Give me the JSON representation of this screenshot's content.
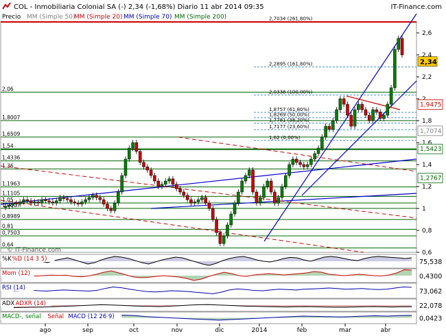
{
  "header": {
    "title_line": "COL - Inmobiliaria Colonial SA (-)   2,34 (-1,68%)   Diario  11 abr 2014 09:35",
    "brand": "IT-Finance.com",
    "watermark": "© IT-Finance.com"
  },
  "legend": {
    "precio": "Precio",
    "items": [
      {
        "label": "MM (Simple 50)",
        "color": "#808080"
      },
      {
        "label": "MM (Simple 20)",
        "color": "#cc0000"
      },
      {
        "label": "MM (Simple 70)",
        "color": "#0000aa"
      },
      {
        "label": "MM (Simple 200)",
        "color": "#006600"
      }
    ]
  },
  "colors": {
    "candle_up": "#008000",
    "candle_down": "#cc0000",
    "support": "#006400",
    "trend_blue": "#0000cc",
    "trend_red": "#cc0000",
    "fib": "#4a90d9"
  },
  "chart_data": [
    {
      "type": "candlestick",
      "ylim": [
        0.6,
        2.7
      ],
      "y_ticks": [
        0.6,
        0.8,
        1,
        1.2,
        1.4,
        1.6,
        1.8,
        2,
        2.2,
        2.4,
        2.6
      ],
      "y_tick_labels": [
        "0,6",
        "0,8",
        "1",
        "1,2",
        "1,4",
        "1,6",
        "1,8",
        "2",
        "2,2",
        "2,4",
        "2,6"
      ],
      "x_labels": [
        "ago",
        "sep",
        "oct",
        "nov",
        "dic",
        "2014",
        "feb",
        "mar",
        "abr"
      ],
      "last_price": "2,34",
      "horizontal_levels": [
        {
          "v": 2.06,
          "t": "2,06"
        },
        {
          "v": 1.8007,
          "t": "1,8007"
        },
        {
          "v": 1.6509,
          "t": "1,6509"
        },
        {
          "v": 1.54,
          "t": "1,54"
        },
        {
          "v": 1.4336,
          "t": "1,4336"
        },
        {
          "v": 1.36,
          "t": "1,36"
        },
        {
          "v": 1.1963,
          "t": "1,1963"
        },
        {
          "v": 1.1105,
          "t": "1,1105"
        },
        {
          "v": 1.05,
          "t": "1,05"
        },
        {
          "v": 1.0007,
          "t": "1,0007"
        },
        {
          "v": 0.8989,
          "t": "0,8989"
        },
        {
          "v": 0.81,
          "t": "0,81"
        },
        {
          "v": 0.7503,
          "t": "0,7503"
        },
        {
          "v": 0.64,
          "t": "0,64"
        }
      ],
      "fib_levels": [
        {
          "v": 2.7034,
          "t": "2,7034 (261,80%)"
        },
        {
          "v": 2.2895,
          "t": "2,2895 (161,80%)"
        },
        {
          "v": 2.0338,
          "t": "2,0338 (100,00%)"
        },
        {
          "v": 1.8757,
          "t": "1,8757 (61,80%)"
        },
        {
          "v": 1.8269,
          "t": "1,8269 (50,00%)"
        },
        {
          "v": 1.7781,
          "t": "1,7781 (38,20%)"
        },
        {
          "v": 1.7177,
          "t": "1,7177 (23,60%)"
        },
        {
          "v": 1.62,
          "t": "1,62 (0,00%)"
        }
      ],
      "right_labels": [
        {
          "v": 1.9475,
          "t": "1,9475",
          "color": "#cc0000"
        },
        {
          "v": 1.7074,
          "t": "1,7074",
          "color": "#808080"
        },
        {
          "v": 1.5423,
          "t": "1,5423",
          "color": "#006600"
        },
        {
          "v": 1.2767,
          "t": "1,2767",
          "color": "#006600"
        }
      ],
      "close_series": [
        1.02,
        1.03,
        1.05,
        1.04,
        1.06,
        1.08,
        1.07,
        1.05,
        1.06,
        1.05,
        1.08,
        1.07,
        1.06,
        1.05,
        1.07,
        1.1,
        1.09,
        1.08,
        1.06,
        1.05,
        1.04,
        1.06,
        1.08,
        1.1,
        1.12,
        1.1,
        1.08,
        1.04,
        1.0,
        0.98,
        1.05,
        1.15,
        1.3,
        1.45,
        1.55,
        1.6,
        1.52,
        1.42,
        1.38,
        1.35,
        1.3,
        1.25,
        1.2,
        1.22,
        1.25,
        1.27,
        1.22,
        1.18,
        1.15,
        1.12,
        1.08,
        1.05,
        1.06,
        1.08,
        1.1,
        1.05,
        1.0,
        0.9,
        0.78,
        0.68,
        0.75,
        0.85,
        0.95,
        1.05,
        1.15,
        1.25,
        1.3,
        1.35,
        1.15,
        1.05,
        1.1,
        1.2,
        1.25,
        1.15,
        1.05,
        1.1,
        1.2,
        1.3,
        1.4,
        1.45,
        1.42,
        1.4,
        1.38,
        1.4,
        1.45,
        1.5,
        1.55,
        1.65,
        1.75,
        1.72,
        1.8,
        1.9,
        2.0,
        1.95,
        1.85,
        1.75,
        1.9,
        1.95,
        1.9,
        1.85,
        1.8,
        1.9,
        1.88,
        1.82,
        1.85,
        1.95,
        2.1,
        2.45,
        2.55,
        2.4
      ]
    },
    {
      "type": "line",
      "name": "%K %D (14 3 5)",
      "value_label": "75,538",
      "ylim": [
        0,
        100
      ],
      "values": [
        45,
        55,
        70,
        60,
        50,
        40,
        55,
        65,
        75,
        60,
        45,
        30,
        40,
        60,
        75,
        85,
        80,
        70,
        55,
        40,
        30,
        45,
        60,
        70,
        80,
        75,
        60,
        45,
        30,
        20,
        35,
        55,
        70,
        80,
        85,
        75,
        60,
        50,
        45,
        55,
        70,
        78,
        75,
        60,
        50,
        65,
        80,
        85,
        80,
        70,
        60,
        55,
        70,
        80,
        85,
        82,
        78,
        75,
        70,
        75
      ]
    },
    {
      "type": "line",
      "name": "Mom (12)",
      "value_label": "0,4300",
      "ylim": [
        -0.5,
        0.5
      ],
      "values": [
        0,
        0.05,
        0.02,
        -0.03,
        0.01,
        0.04,
        0.02,
        0.03,
        -0.05,
        -0.08,
        -0.02,
        0.1,
        0.25,
        0.35,
        0.2,
        0.05,
        -0.1,
        -0.15,
        -0.12,
        -0.05,
        0.0,
        -0.05,
        -0.1,
        -0.2,
        -0.35,
        -0.25,
        -0.05,
        0.1,
        0.25,
        0.15,
        0.0,
        -0.05,
        0.05,
        0.1,
        0.15,
        0.1,
        0.05,
        0.1,
        0.15,
        0.2,
        0.3,
        0.25,
        0.1,
        0.05,
        0.0,
        0.05,
        0.1,
        0.05,
        0.0,
        -0.02,
        0.05,
        0.2,
        0.43,
        0.4
      ]
    },
    {
      "type": "line",
      "name": "RSI (14)",
      "value_label": "73,062",
      "ylim": [
        0,
        100
      ],
      "values": [
        50,
        52,
        55,
        50,
        48,
        52,
        55,
        53,
        50,
        48,
        52,
        65,
        75,
        70,
        60,
        52,
        45,
        42,
        45,
        50,
        48,
        45,
        40,
        35,
        30,
        40,
        55,
        62,
        58,
        52,
        50,
        55,
        60,
        58,
        55,
        60,
        62,
        65,
        68,
        65,
        60,
        62,
        65,
        60,
        58,
        60,
        68,
        75,
        73
      ]
    },
    {
      "type": "line",
      "name": "ADX ADXR (14)",
      "value_label": "22,078",
      "ylim": [
        0,
        60
      ],
      "values": [
        18,
        19,
        20,
        21,
        22,
        24,
        26,
        28,
        30,
        32,
        31,
        29,
        27,
        25,
        24,
        23,
        25,
        27,
        30,
        32,
        33,
        31,
        29,
        27,
        25,
        24,
        23,
        22,
        21,
        22,
        23,
        22,
        21,
        20,
        20,
        21,
        22,
        23,
        22,
        21,
        22,
        22
      ]
    },
    {
      "type": "line",
      "name": "MACD- señal Señal MACD (12 26 9)",
      "value_label": "0,0423",
      "ylim": [
        -0.1,
        0.1
      ],
      "values": [
        0,
        0.005,
        0.01,
        0.005,
        0,
        -0.005,
        0,
        0.01,
        0.03,
        0.045,
        0.04,
        0.02,
        0.01,
        0,
        -0.01,
        -0.02,
        -0.03,
        -0.04,
        -0.03,
        -0.02,
        -0.01,
        0,
        0.01,
        0.02,
        0.03,
        0.025,
        0.02,
        0.015,
        0.02,
        0.03,
        0.035,
        0.03,
        0.04,
        0.0423
      ]
    }
  ],
  "indicators": [
    {
      "labels": [
        {
          "t": "%K",
          "c": "#000000"
        },
        {
          "t": "%D (14 3 5)",
          "c": "#cc0000"
        }
      ],
      "value": "75,538"
    },
    {
      "labels": [
        {
          "t": "Mom (12)",
          "c": "#cc0000"
        }
      ],
      "value": "0,4300"
    },
    {
      "labels": [
        {
          "t": "RSI (14)",
          "c": "#0000aa"
        }
      ],
      "value": "73,062"
    },
    {
      "labels": [
        {
          "t": "ADX",
          "c": "#000000"
        },
        {
          "t": "ADXR (14)",
          "c": "#cc0000"
        }
      ],
      "value": "22,078"
    },
    {
      "labels": [
        {
          "t": "MACD-, señal",
          "c": "#008000"
        },
        {
          "t": "Señal",
          "c": "#cc0000"
        },
        {
          "t": "MACD (12 26 9)",
          "c": "#0000aa"
        }
      ],
      "value": "0,0423"
    }
  ]
}
